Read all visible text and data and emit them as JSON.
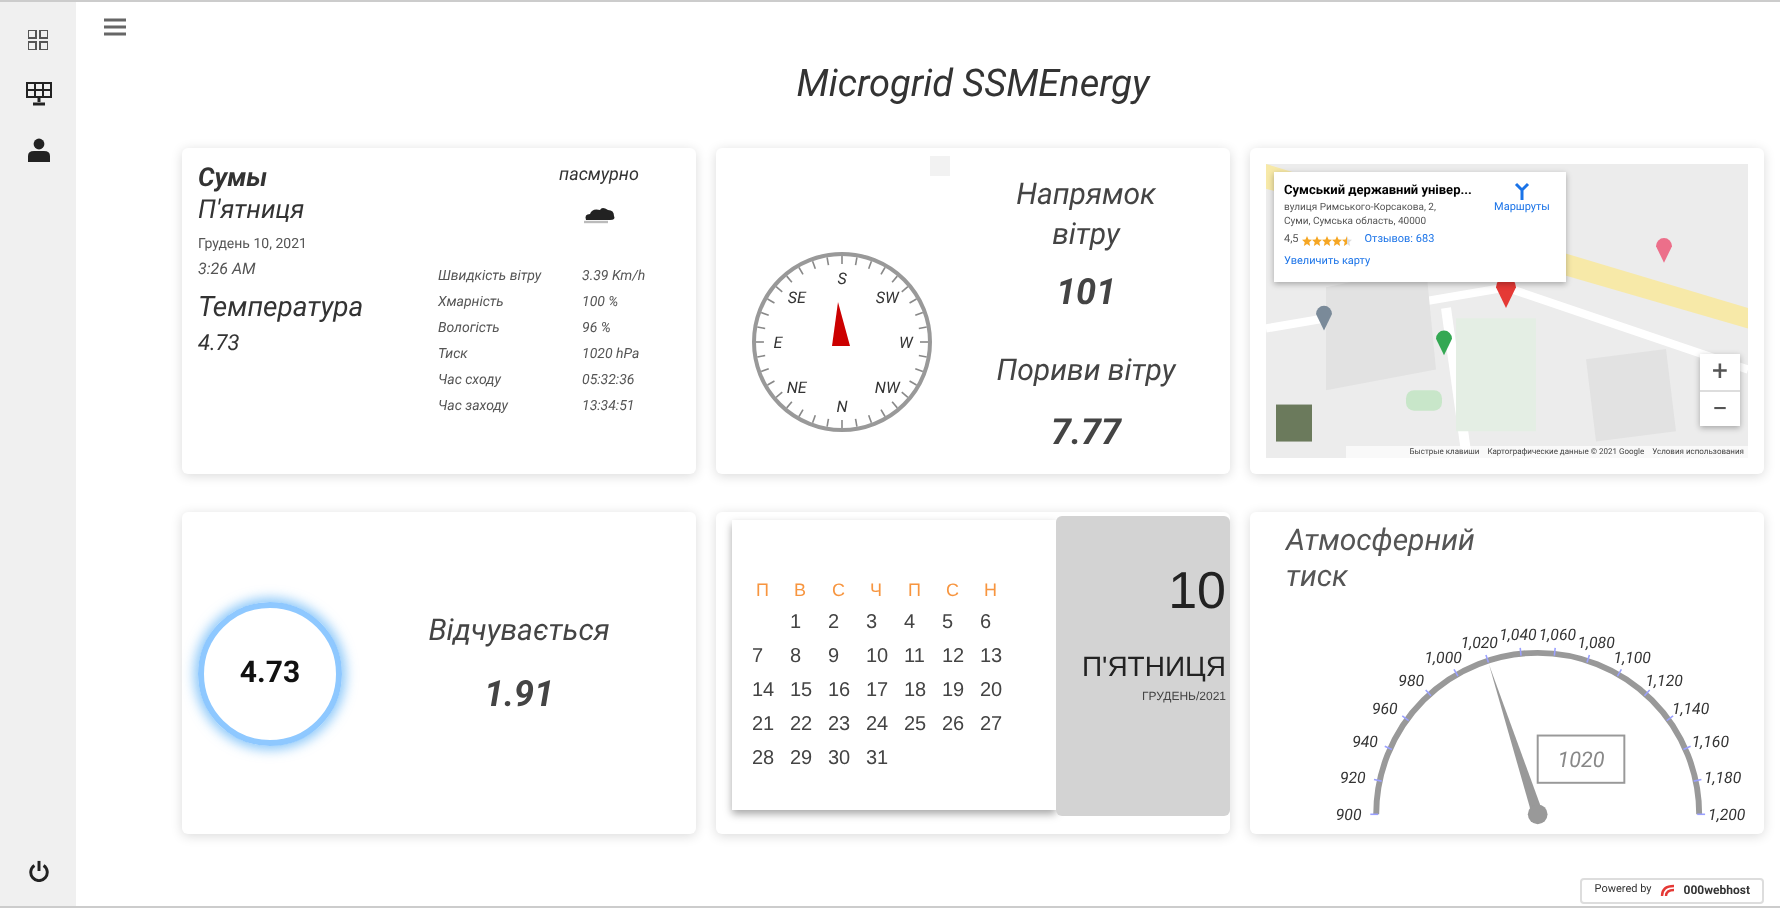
{
  "title": "Microgrid SSMEnergy",
  "weather": {
    "city": "Сумы",
    "weekday": "П'ятниця",
    "date": "Грудень 10, 2021",
    "time": "3:26 AM",
    "condition": "пасмурно",
    "temperature_label": "Температура",
    "temperature": "4.73",
    "details": [
      {
        "label": "Швидкість вітру",
        "value": "3.39 Km/h"
      },
      {
        "label": "Хмарність",
        "value": "100 %"
      },
      {
        "label": "Вологість",
        "value": "96 %"
      },
      {
        "label": "Тиск",
        "value": "1020 hPa"
      },
      {
        "label": "Час сходу",
        "value": "05:32:36"
      },
      {
        "label": "Час заходу",
        "value": "13:34:51"
      }
    ]
  },
  "wind": {
    "compass_labels": [
      "S",
      "SW",
      "W",
      "NW",
      "N",
      "NE",
      "E",
      "SE"
    ],
    "direction_label": "Напрямок вітру",
    "direction": "101",
    "gusts_label": "Пориви вітру",
    "gusts": "7.77"
  },
  "map": {
    "place_title": "Сумський державний універ...",
    "address_line_1": "вулиця Римського-Корсакова, 2,",
    "address_line_2": "Суми, Сумська область, 40000",
    "rating": "4,5",
    "stars": 4.5,
    "reviews": "Отзывов: 683",
    "enlarge": "Увеличить карту",
    "directions": "Маршруты",
    "zoom_in": "+",
    "zoom_out": "−",
    "attribution": [
      "Быстрые клавиши",
      "Картографические данные © 2021 Google",
      "Условия использования"
    ]
  },
  "feels_like": {
    "value": "4.73",
    "label": "Відчувається",
    "feels": "1.91"
  },
  "calendar": {
    "weekdays": [
      "П",
      "В",
      "С",
      "Ч",
      "П",
      "С",
      "Н"
    ],
    "weeks": [
      [
        "1",
        "2",
        "3",
        "4",
        "5",
        "6"
      ],
      [
        "7",
        "8",
        "9",
        "10",
        "11",
        "12",
        "13"
      ],
      [
        "14",
        "15",
        "16",
        "17",
        "18",
        "19",
        "20"
      ],
      [
        "21",
        "22",
        "23",
        "24",
        "25",
        "26",
        "27"
      ],
      [
        "28",
        "29",
        "30",
        "31"
      ]
    ],
    "day": "10",
    "weekday": "П'ЯТНИЦЯ",
    "month_year": "ГРУДЕНЬ/2021"
  },
  "pressure": {
    "title_line_1": "Атмосферний",
    "title_line_2": "тиск",
    "labels": [
      "900",
      "920",
      "940",
      "960",
      "980",
      "1,000",
      "1,020",
      "1,040",
      "1,060",
      "1,080",
      "1,100",
      "1,120",
      "1,140",
      "1,160",
      "1,180",
      "1,200"
    ],
    "level": 0.4,
    "reading": "1020"
  },
  "footer": {
    "powered_by": "Powered by",
    "host": "000webhost"
  }
}
